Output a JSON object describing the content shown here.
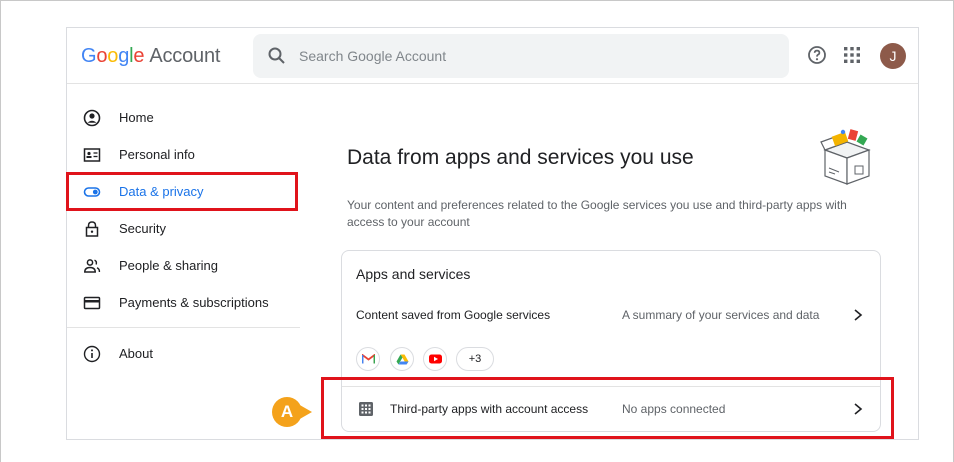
{
  "header": {
    "logo_google": [
      "G",
      "o",
      "o",
      "g",
      "l",
      "e"
    ],
    "logo_suffix": "Account",
    "search_placeholder": "Search Google Account",
    "avatar_initial": "J"
  },
  "sidebar": {
    "items": [
      {
        "label": "Home",
        "icon": "home-icon",
        "active": false
      },
      {
        "label": "Personal info",
        "icon": "id-card-icon",
        "active": false
      },
      {
        "label": "Data & privacy",
        "icon": "toggle-icon",
        "active": true
      },
      {
        "label": "Security",
        "icon": "lock-icon",
        "active": false
      },
      {
        "label": "People & sharing",
        "icon": "people-icon",
        "active": false
      },
      {
        "label": "Payments & subscriptions",
        "icon": "card-icon",
        "active": false
      },
      {
        "label": "About",
        "icon": "info-icon",
        "active": false
      }
    ]
  },
  "main": {
    "title": "Data from apps and services you use",
    "description": "Your content and preferences related to the Google services you use and third-party apps with access to your account",
    "card": {
      "title": "Apps and services",
      "content_row": {
        "label": "Content saved from Google services",
        "value": "A summary of your services and data"
      },
      "chips": [
        "gmail-icon",
        "drive-icon",
        "youtube-icon"
      ],
      "chips_more": "+3",
      "third_party_row": {
        "label": "Third-party apps with account access",
        "value": "No apps connected"
      }
    }
  },
  "annotation": {
    "badge": "A"
  },
  "colors": {
    "accent": "#1a73e8",
    "highlight": "#e0131b",
    "badge": "#f4a21b",
    "avatar": "#8d5a4a"
  }
}
